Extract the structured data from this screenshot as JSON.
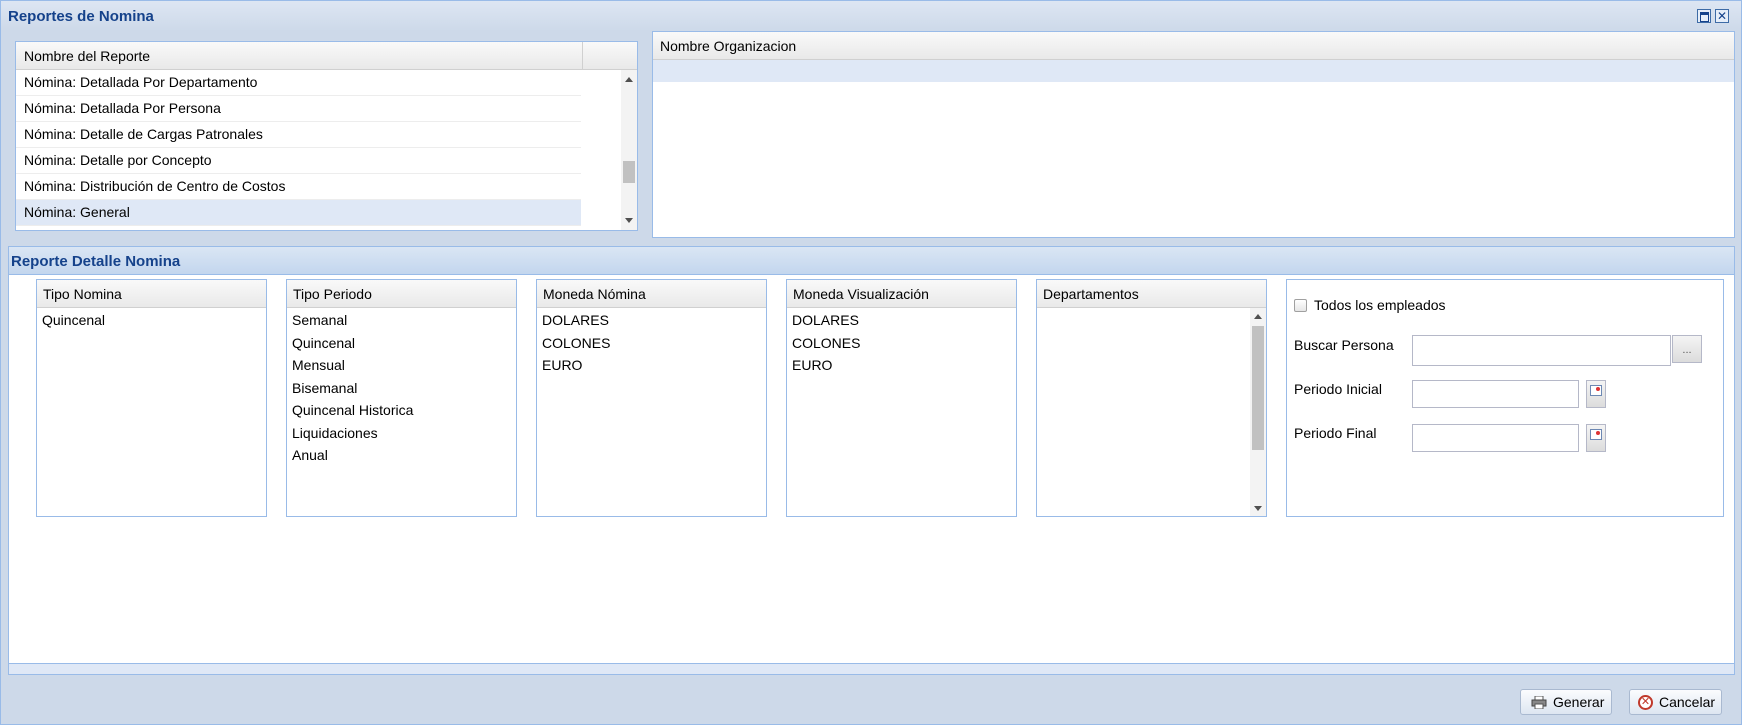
{
  "window": {
    "title": "Reportes de Nomina",
    "maximize_icon": "maximize-icon",
    "close_icon": "close-icon",
    "close_glyph": "✕"
  },
  "reports_grid": {
    "column_header": "Nombre del Reporte",
    "rows": [
      "Nómina: Detallada Por Departamento",
      "Nómina: Detallada Por Persona",
      "Nómina: Detalle de Cargas Patronales",
      "Nómina: Detalle por Concepto",
      "Nómina: Distribución de Centro de Costos",
      "Nómina: General"
    ],
    "selected_row": "Nómina: General"
  },
  "org_grid": {
    "column_header": "Nombre Organizacion"
  },
  "detail_panel": {
    "title": "Reporte Detalle Nomina",
    "tipo_nomina": {
      "header": "Tipo Nomina",
      "items": [
        "Quincenal"
      ]
    },
    "tipo_periodo": {
      "header": "Tipo Periodo",
      "items": [
        "Semanal",
        "Quincenal",
        "Mensual",
        "Bisemanal",
        "Quincenal Historica",
        "Liquidaciones",
        "Anual"
      ]
    },
    "moneda_nomina": {
      "header": "Moneda Nómina",
      "items": [
        "DOLARES",
        "COLONES",
        "EURO"
      ]
    },
    "moneda_visualizacion": {
      "header": "Moneda Visualización",
      "items": [
        "DOLARES",
        "COLONES",
        "EURO"
      ]
    },
    "departamentos": {
      "header": "Departamentos",
      "items": []
    },
    "form": {
      "todos_label": "Todos los empleados",
      "todos_checked": false,
      "buscar_label": "Buscar Persona",
      "buscar_value": "",
      "buscar_trigger": "...",
      "periodo_inicial_label": "Periodo Inicial",
      "periodo_inicial_value": "",
      "periodo_final_label": "Periodo Final",
      "periodo_final_value": ""
    }
  },
  "buttons": {
    "generar": "Generar",
    "cancelar": "Cancelar",
    "generar_icon": "printer-icon",
    "cancelar_icon": "cancel-icon",
    "cancel_glyph": "✕"
  },
  "colors": {
    "title": "#15428b",
    "border": "#99bbe8",
    "window_bg": "#cdd9e9",
    "selection": "#dfe8f6"
  }
}
